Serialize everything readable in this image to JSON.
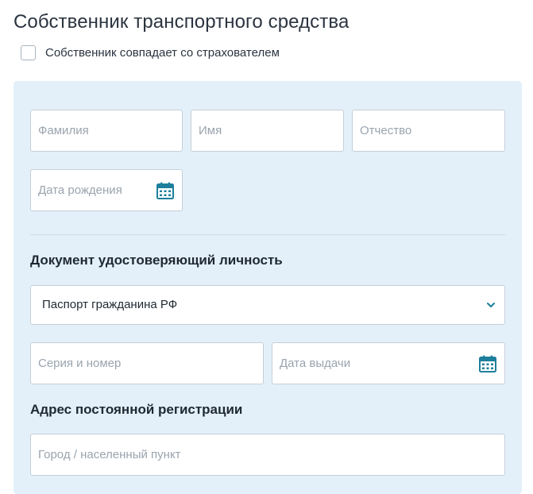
{
  "page": {
    "title": "Собственник транспортного средства",
    "same_as_insurer_label": "Собственник совпадает со страхователем"
  },
  "form": {
    "last_name_placeholder": "Фамилия",
    "first_name_placeholder": "Имя",
    "middle_name_placeholder": "Отчество",
    "birth_date_placeholder": "Дата рождения",
    "identity_section_title": "Документ удостоверяющий личность",
    "document_type_value": "Паспорт гражданина РФ",
    "series_number_placeholder": "Серия и номер",
    "issue_date_placeholder": "Дата выдачи",
    "address_section_title": "Адрес постоянной регистрации",
    "city_placeholder": "Город / населенный пункт"
  },
  "icons": {
    "calendar": "calendar-icon",
    "dropdown": "chevron-down-icon"
  },
  "colors": {
    "panel_bg": "#e3f0f9",
    "accent": "#1d7f9c",
    "border": "#c5cfd8",
    "placeholder": "#9aa4ae"
  }
}
